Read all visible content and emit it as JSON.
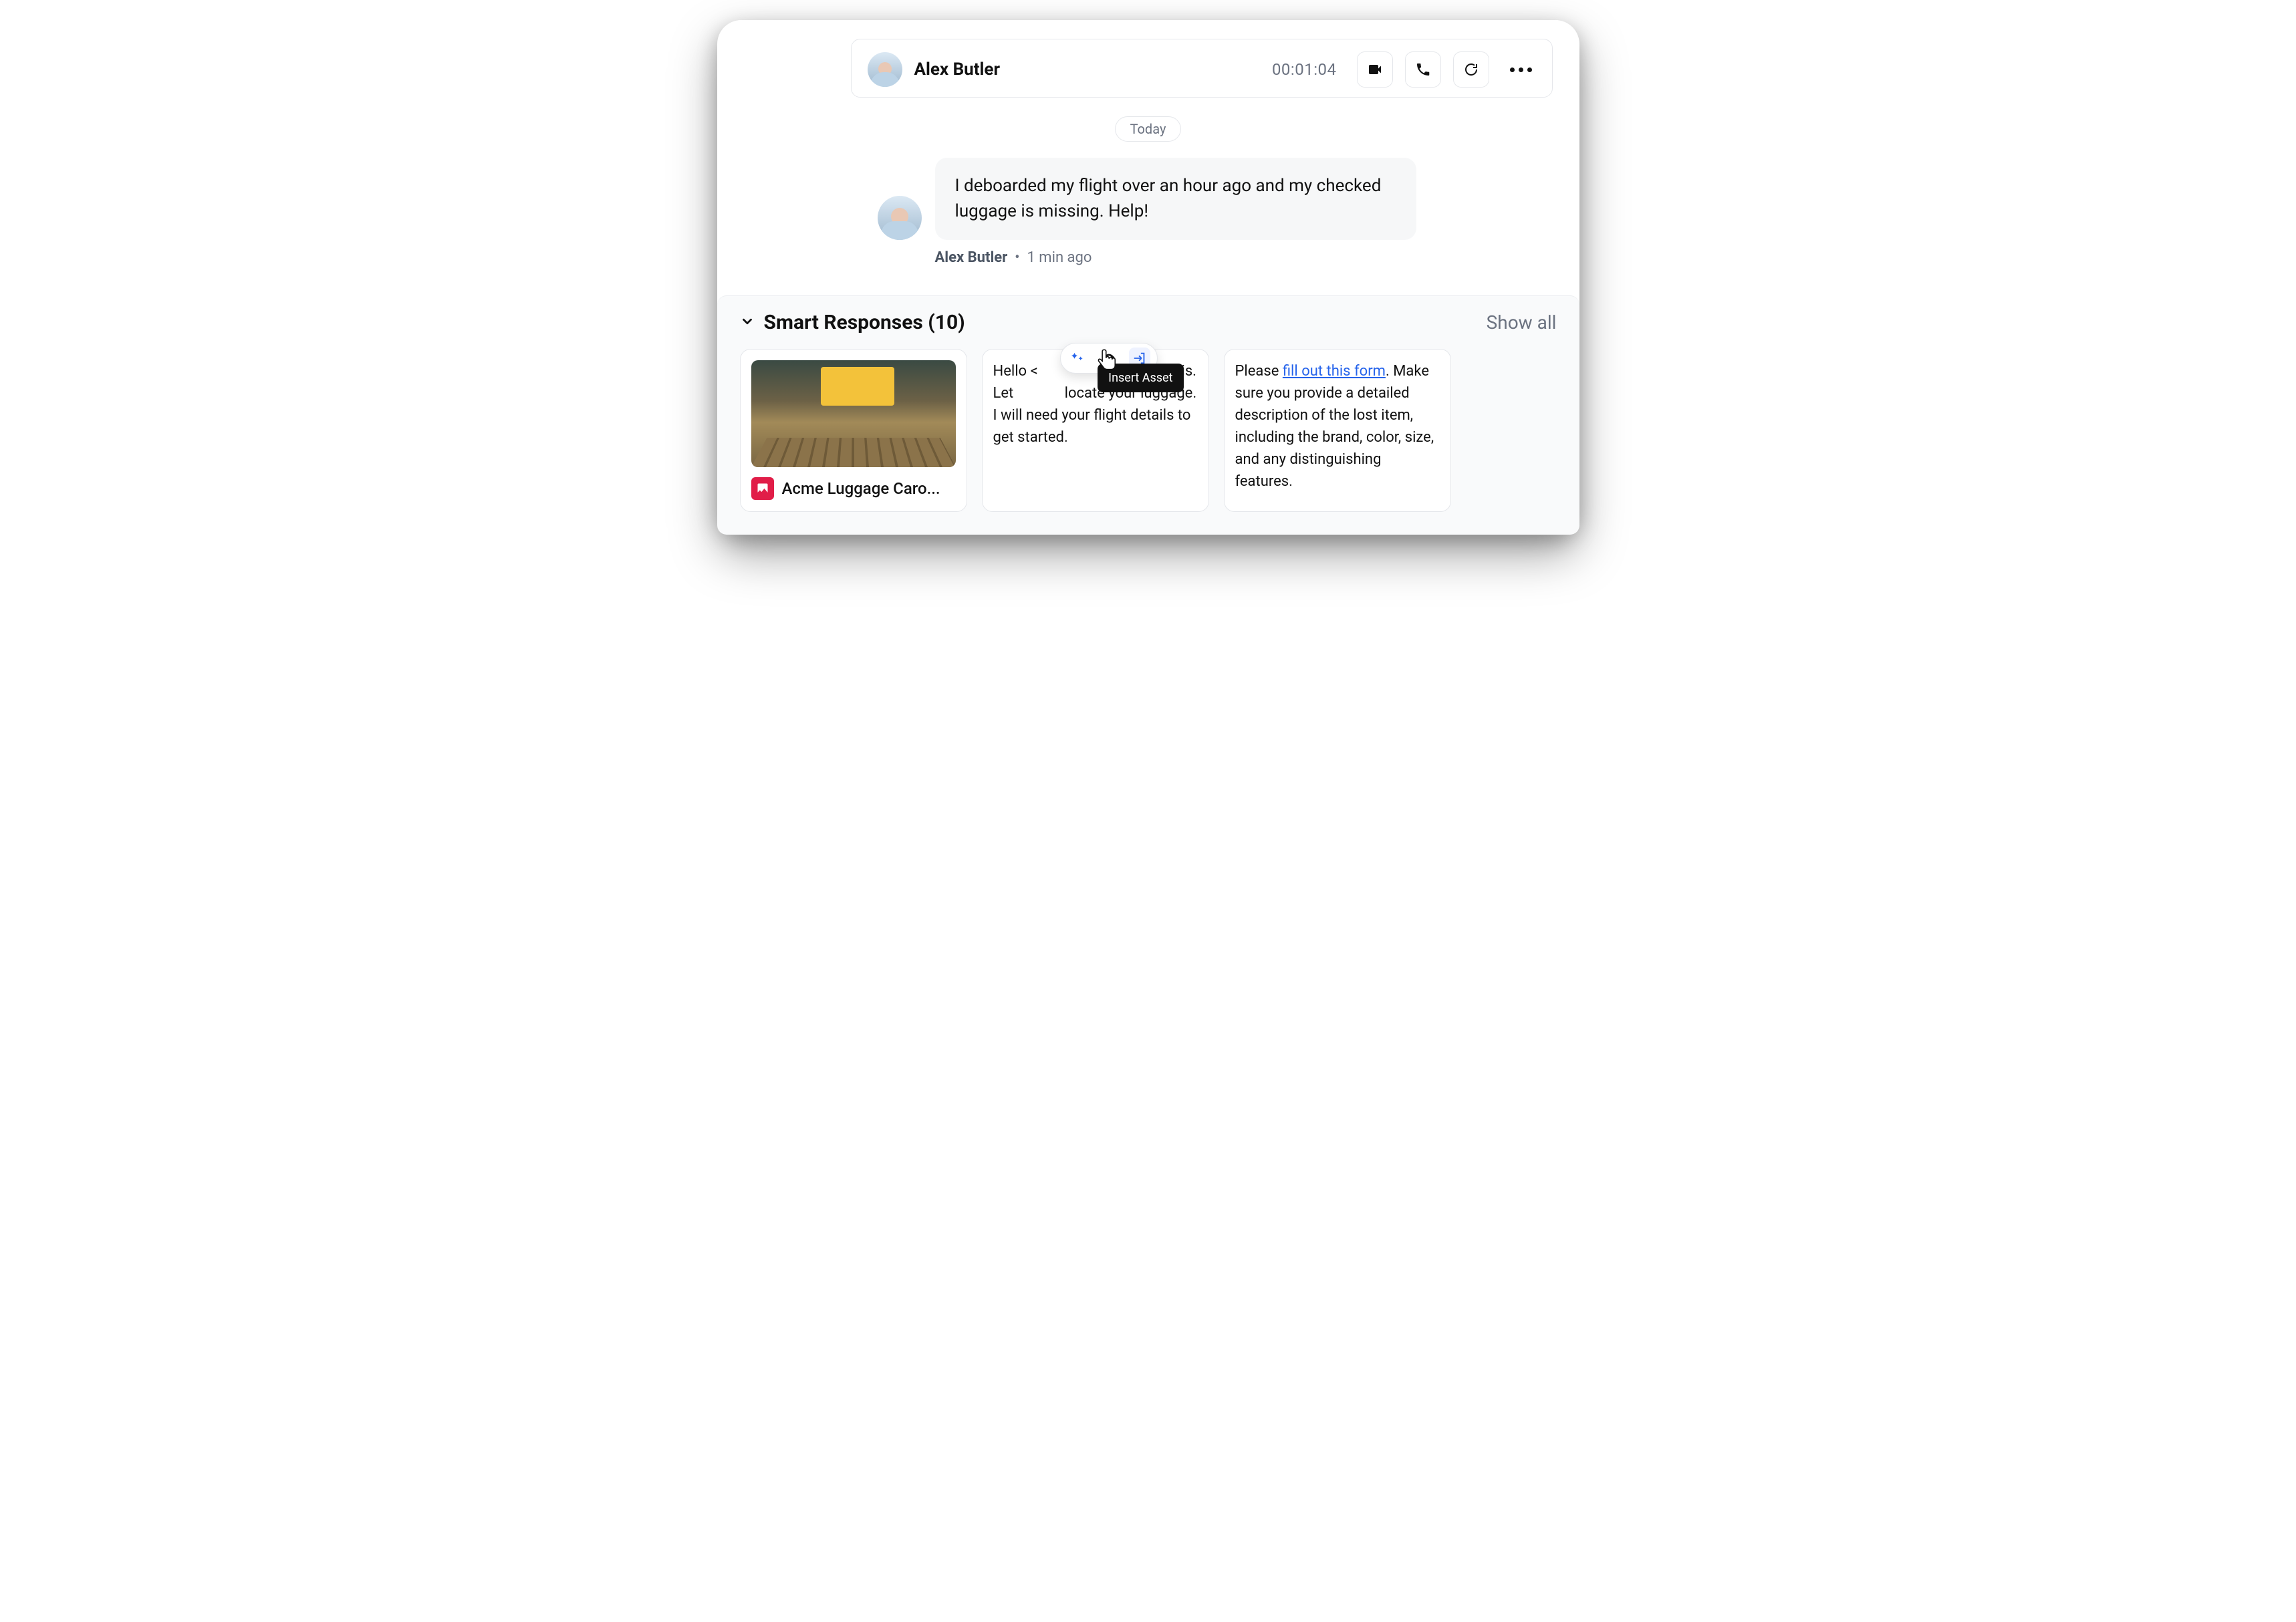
{
  "header": {
    "contact_name": "Alex Butler",
    "timer": "00:01:04"
  },
  "conversation": {
    "date_label": "Today",
    "message": {
      "text": "I deboarded my flight over an hour ago and my checked luggage is missing. Help!",
      "author": "Alex Butler",
      "time_ago": "1 min ago"
    }
  },
  "smart_responses": {
    "title": "Smart Responses (10)",
    "show_all": "Show all",
    "hover_tooltip": "Insert Asset",
    "cards": [
      {
        "type": "asset",
        "label": "Acme Luggage Caro..."
      },
      {
        "type": "text",
        "text_prefix": "Hello <",
        "text_suffix": "ry to hear this. Let",
        "text_rest": "locate your luggage.  I will need your flight details to get started."
      },
      {
        "type": "text_link",
        "prefix": "Please ",
        "link_text": "fill out this form",
        "suffix": ". Make sure you provide a detailed description of the lost item, including the brand, color, size, and any distinguishing features."
      }
    ]
  }
}
